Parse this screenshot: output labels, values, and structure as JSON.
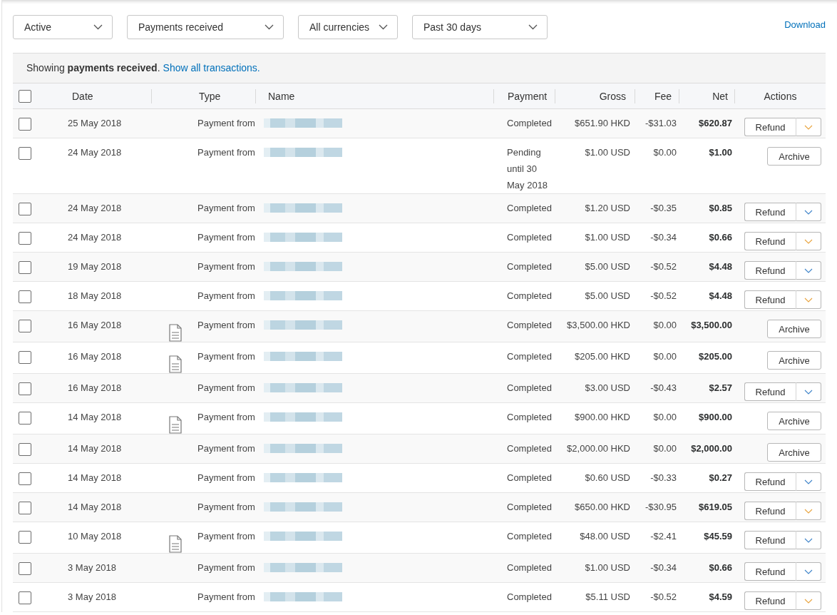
{
  "filters": [
    "Active",
    "Payments received",
    "All currencies",
    "Past 30 days"
  ],
  "download_link": "Download",
  "notice": {
    "text": "Showing **payments received**.",
    "link": "Show all transactions."
  },
  "table": {
    "select_all": {
      "checked": false
    },
    "columns": [
      "Date",
      "Type",
      "Name",
      "Payment",
      "Gross",
      "Fee",
      "Net",
      "Actions"
    ],
    "rows": [
      {
        "checked": false,
        "date": "25 May 2018",
        "attachment": false,
        "type": "Payment from",
        "status": "Completed",
        "gross": "$651.90 HKD",
        "fee": "-$31.03",
        "net": "$620.87",
        "action": {
          "kind": "refund",
          "label": "Refund",
          "color": "#e8a33c"
        }
      },
      {
        "checked": false,
        "date": "24 May 2018",
        "attachment": false,
        "type": "Payment from",
        "status": "Pending until 30 May 2018",
        "gross": "$1.00 USD",
        "fee": "$0.00",
        "net": "$1.00",
        "action": {
          "kind": "archive",
          "label": "Archive"
        }
      },
      {
        "checked": false,
        "date": "24 May 2018",
        "attachment": false,
        "type": "Payment from",
        "status": "Completed",
        "gross": "$1.20 USD",
        "fee": "-$0.35",
        "net": "$0.85",
        "action": {
          "kind": "refund",
          "label": "Refund",
          "color": "#3d83c9"
        }
      },
      {
        "checked": false,
        "date": "24 May 2018",
        "attachment": false,
        "type": "Payment from",
        "status": "Completed",
        "gross": "$1.00 USD",
        "fee": "-$0.34",
        "net": "$0.66",
        "action": {
          "kind": "refund",
          "label": "Refund",
          "color": "#e8a33c"
        }
      },
      {
        "checked": false,
        "date": "19 May 2018",
        "attachment": false,
        "type": "Payment from",
        "status": "Completed",
        "gross": "$5.00 USD",
        "fee": "-$0.52",
        "net": "$4.48",
        "action": {
          "kind": "refund",
          "label": "Refund",
          "color": "#3d83c9"
        }
      },
      {
        "checked": false,
        "date": "18 May 2018",
        "attachment": false,
        "type": "Payment from",
        "status": "Completed",
        "gross": "$5.00 USD",
        "fee": "-$0.52",
        "net": "$4.48",
        "action": {
          "kind": "refund",
          "label": "Refund",
          "color": "#e8a33c"
        }
      },
      {
        "checked": false,
        "date": "16 May 2018",
        "attachment": true,
        "type": "Payment from",
        "status": "Completed",
        "gross": "$3,500.00 HKD",
        "fee": "$0.00",
        "net": "$3,500.00",
        "action": {
          "kind": "archive",
          "label": "Archive"
        }
      },
      {
        "checked": false,
        "date": "16 May 2018",
        "attachment": true,
        "type": "Payment from",
        "status": "Completed",
        "gross": "$205.00 HKD",
        "fee": "$0.00",
        "net": "$205.00",
        "action": {
          "kind": "archive",
          "label": "Archive"
        }
      },
      {
        "checked": false,
        "date": "16 May 2018",
        "attachment": false,
        "type": "Payment from",
        "status": "Completed",
        "gross": "$3.00 USD",
        "fee": "-$0.43",
        "net": "$2.57",
        "action": {
          "kind": "refund",
          "label": "Refund",
          "color": "#3d83c9"
        }
      },
      {
        "checked": false,
        "date": "14 May 2018",
        "attachment": true,
        "type": "Payment from",
        "status": "Completed",
        "gross": "$900.00 HKD",
        "fee": "$0.00",
        "net": "$900.00",
        "action": {
          "kind": "archive",
          "label": "Archive"
        }
      },
      {
        "checked": false,
        "date": "14 May 2018",
        "attachment": false,
        "type": "Payment from",
        "status": "Completed",
        "gross": "$2,000.00 HKD",
        "fee": "$0.00",
        "net": "$2,000.00",
        "action": {
          "kind": "archive",
          "label": "Archive"
        }
      },
      {
        "checked": false,
        "date": "14 May 2018",
        "attachment": false,
        "type": "Payment from",
        "status": "Completed",
        "gross": "$0.60 USD",
        "fee": "-$0.33",
        "net": "$0.27",
        "action": {
          "kind": "refund",
          "label": "Refund",
          "color": "#3d83c9"
        }
      },
      {
        "checked": false,
        "date": "14 May 2018",
        "attachment": false,
        "type": "Payment from",
        "status": "Completed",
        "gross": "$650.00 HKD",
        "fee": "-$30.95",
        "net": "$619.05",
        "action": {
          "kind": "refund",
          "label": "Refund",
          "color": "#e8a33c"
        }
      },
      {
        "checked": false,
        "date": "10 May 2018",
        "attachment": true,
        "type": "Payment from",
        "status": "Completed",
        "gross": "$48.00 USD",
        "fee": "-$2.41",
        "net": "$45.59",
        "action": {
          "kind": "refund",
          "label": "Refund",
          "color": "#3d83c9"
        }
      },
      {
        "checked": false,
        "date": "3 May 2018",
        "attachment": false,
        "type": "Payment from",
        "status": "Completed",
        "gross": "$1.00 USD",
        "fee": "-$0.34",
        "net": "$0.66",
        "action": {
          "kind": "refund",
          "label": "Refund",
          "color": "#3d83c9"
        }
      },
      {
        "checked": false,
        "date": "3 May 2018",
        "attachment": false,
        "type": "Payment from",
        "status": "Completed",
        "gross": "$5.11 USD",
        "fee": "-$0.52",
        "net": "$4.59",
        "action": {
          "kind": "refund",
          "label": "Refund",
          "color": "#e8a33c"
        }
      }
    ]
  }
}
